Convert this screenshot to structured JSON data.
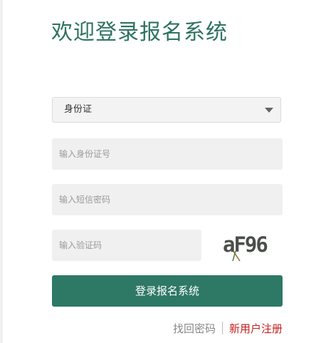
{
  "page": {
    "title": "欢迎登录报名系统"
  },
  "id_type_select": {
    "selected": "身份证"
  },
  "fields": {
    "id_number_placeholder": "输入身份证号",
    "sms_code_placeholder": "输入短信密码",
    "captcha_placeholder": "输入验证码"
  },
  "captcha": {
    "text": "aF96"
  },
  "login_button": {
    "label": "登录报名系统"
  },
  "links": {
    "forgot_password": "找回密码",
    "register": "新用户注册"
  },
  "colors": {
    "brand": "#2e7866",
    "title": "#2e7360",
    "register_link": "#c11f1f"
  }
}
